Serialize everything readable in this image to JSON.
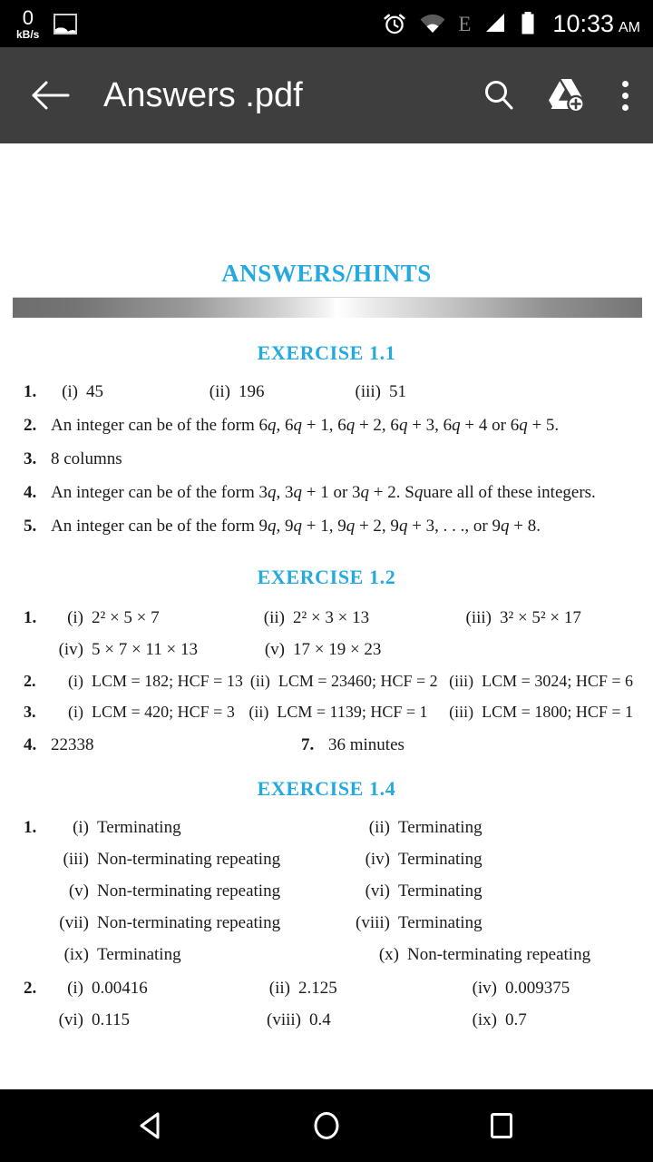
{
  "status_bar": {
    "network_speed_value": "0",
    "network_speed_unit": "kB/s",
    "photo_icon": "photo-icon",
    "alarm_icon": "alarm-icon",
    "wifi_icon": "wifi-icon",
    "network_type": "E",
    "signal_icon": "signal-icon",
    "battery_icon": "battery-icon",
    "time": "10:33",
    "meridiem": "AM",
    "background": "#000000"
  },
  "app_bar": {
    "back_icon": "back-arrow-icon",
    "title": "Answers .pdf",
    "search_icon": "search-icon",
    "drive_icon": "drive-upload-icon",
    "overflow_icon": "overflow-menu-icon",
    "background": "#3e3e3e"
  },
  "document": {
    "title": "ANSWERS/HINTS",
    "heading_color": "#24a9e0",
    "sections": [
      {
        "heading": "EXERCISE  1.1",
        "lines": [
          {
            "type": "cols3",
            "num": "1.",
            "cells": [
              {
                "lbl": "(i)",
                "txt": "45"
              },
              {
                "lbl": "(ii)",
                "txt": "196"
              },
              {
                "lbl": "(iii)",
                "txt": "51"
              }
            ]
          },
          {
            "type": "text",
            "num": "2.",
            "txt": "An integer can be of the form 6q, 6q + 1, 6q + 2, 6q + 3, 6q + 4 or 6q + 5."
          },
          {
            "type": "text",
            "num": "3.",
            "txt": "8 columns"
          },
          {
            "type": "text",
            "num": "4.",
            "txt": "An integer can be of the form 3q, 3q + 1 or 3q + 2. Square all of these integers."
          },
          {
            "type": "text",
            "num": "5.",
            "txt": "An integer can be of the form 9q, 9q + 1, 9q + 2, 9q + 3, . . ., or 9q + 8."
          }
        ]
      },
      {
        "heading": "EXERCISE  1.2",
        "lines": [
          {
            "type": "cols3",
            "num": "1.",
            "cells": [
              {
                "lbl": "(i)",
                "txt": "2² × 5 × 7"
              },
              {
                "lbl": "(ii)",
                "txt": "2² × 3 × 13"
              },
              {
                "lbl": "(iii)",
                "txt": "3² × 5² × 17"
              }
            ]
          },
          {
            "type": "cols3",
            "num": "",
            "cells": [
              {
                "lbl": "(iv)",
                "txt": "5 × 7 × 11 × 13"
              },
              {
                "lbl": "(v)",
                "txt": "17 × 19 × 23"
              },
              {
                "lbl": "",
                "txt": ""
              }
            ]
          },
          {
            "type": "cols3lcm",
            "num": "2.",
            "cells": [
              {
                "lbl": "(i)",
                "txt": "LCM = 182; HCF = 13"
              },
              {
                "lbl": "(ii)",
                "txt": "LCM = 23460; HCF = 2"
              },
              {
                "lbl": "(iii)",
                "txt": "LCM = 3024; HCF = 6"
              }
            ]
          },
          {
            "type": "cols3lcm",
            "num": "3.",
            "cells": [
              {
                "lbl": "(i)",
                "txt": "LCM = 420; HCF = 3"
              },
              {
                "lbl": "(ii)",
                "txt": "LCM = 1139; HCF = 1"
              },
              {
                "lbl": "(iii)",
                "txt": "LCM = 1800; HCF = 1"
              }
            ]
          },
          {
            "type": "pair",
            "num": "4.",
            "txt": "22338",
            "num2": "7.",
            "txt2": "36 minutes"
          }
        ]
      },
      {
        "heading": "EXERCISE  1.4",
        "lines": [
          {
            "type": "cols2",
            "num": "1.",
            "cells": [
              {
                "lbl": "(i)",
                "txt": "Terminating"
              },
              {
                "lbl": "(ii)",
                "txt": "Terminating"
              }
            ]
          },
          {
            "type": "cols2",
            "num": "",
            "cells": [
              {
                "lbl": "(iii)",
                "txt": "Non-terminating repeating"
              },
              {
                "lbl": "(iv)",
                "txt": "Terminating"
              }
            ]
          },
          {
            "type": "cols2",
            "num": "",
            "cells": [
              {
                "lbl": "(v)",
                "txt": "Non-terminating repeating"
              },
              {
                "lbl": "(vi)",
                "txt": "Terminating"
              }
            ]
          },
          {
            "type": "cols2",
            "num": "",
            "cells": [
              {
                "lbl": "(vii)",
                "txt": "Non-terminating repeating"
              },
              {
                "lbl": "(viii)",
                "txt": "Terminating"
              }
            ]
          },
          {
            "type": "cols2b",
            "num": "",
            "cells": [
              {
                "lbl": "(ix)",
                "txt": "Terminating"
              },
              {
                "lbl": "(x)",
                "txt": "Non-terminating repeating"
              }
            ]
          },
          {
            "type": "cols3",
            "num": "2.",
            "cells": [
              {
                "lbl": "(i)",
                "txt": "0.00416"
              },
              {
                "lbl": "(ii)",
                "txt": "2.125"
              },
              {
                "lbl": "(iv)",
                "txt": "0.009375"
              }
            ]
          },
          {
            "type": "cols3",
            "num": "",
            "cells": [
              {
                "lbl": "(vi)",
                "txt": "0.115"
              },
              {
                "lbl": "(viii)",
                "txt": "0.4"
              },
              {
                "lbl": "(ix)",
                "txt": "0.7"
              }
            ]
          }
        ]
      }
    ]
  },
  "nav_bar": {
    "back_icon": "nav-back-icon",
    "home_icon": "nav-home-icon",
    "recents_icon": "nav-recents-icon",
    "background": "#000000"
  }
}
